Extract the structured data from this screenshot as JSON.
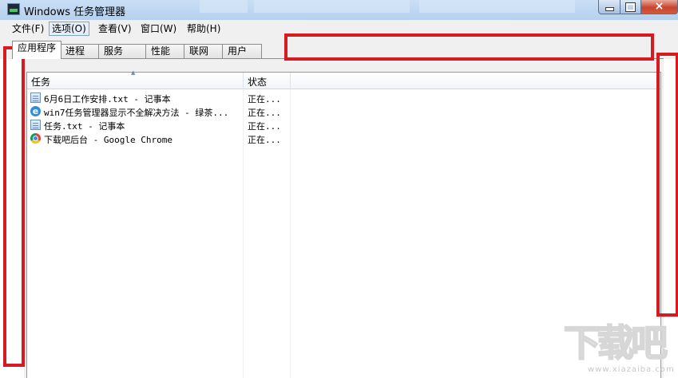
{
  "window": {
    "title": "Windows 任务管理器",
    "controls": {
      "minimize": "minimize-icon",
      "maximize": "maximize-icon",
      "close": "×"
    }
  },
  "menubar": {
    "items": [
      "文件(F)",
      "选项(O)",
      "查看(V)",
      "窗口(W)",
      "帮助(H)"
    ],
    "active": "选项(O)"
  },
  "tabs": {
    "items": [
      "应用程序",
      "进程",
      "服务",
      "性能",
      "联网",
      "用户"
    ],
    "selected": "应用程序"
  },
  "table": {
    "columns": [
      "任务",
      "状态"
    ],
    "sorted_column": "任务",
    "rows": [
      {
        "icon": "notepad-icon",
        "task": "6月6日工作安排.txt - 记事本",
        "status": "正在..."
      },
      {
        "icon": "ie-icon",
        "task": "win7任务管理器显示不全解决方法 - 绿茶...",
        "status": "正在..."
      },
      {
        "icon": "notepad-icon",
        "task": "任务.txt - 记事本",
        "status": "正在..."
      },
      {
        "icon": "chrome-icon",
        "task": "下载吧后台 - Google Chrome",
        "status": "正在..."
      }
    ]
  },
  "annotations": {
    "color": "#d71920",
    "count": 3
  },
  "watermark": {
    "text": "下载吧",
    "sub": "www.xiazaiba.com"
  }
}
